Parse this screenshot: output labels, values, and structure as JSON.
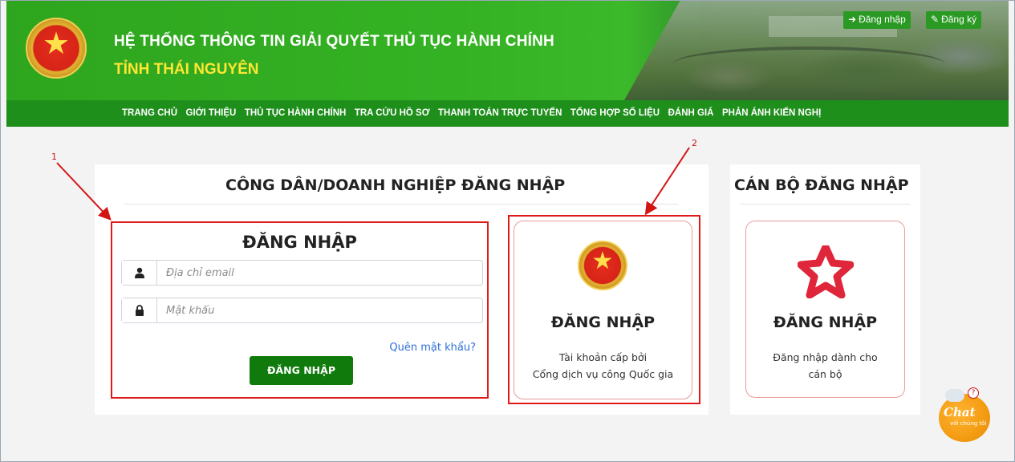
{
  "header": {
    "title_line1": "HỆ THỐNG THÔNG TIN GIẢI QUYẾT THỦ TỤC HÀNH CHÍNH",
    "title_line2": "TỈNH THÁI NGUYÊN",
    "login_label": "Đăng nhập",
    "register_label": "Đăng ký"
  },
  "nav": {
    "items": [
      "TRANG CHỦ",
      "GIỚI THIỆU",
      "THỦ TỤC HÀNH CHÍNH",
      "TRA CỨU HỒ SƠ",
      "THANH TOÁN TRỰC TUYẾN",
      "TỔNG HỢP SỐ LIỆU",
      "ĐÁNH GIÁ",
      "PHẢN ÁNH KIẾN NGHỊ"
    ]
  },
  "citizen": {
    "title": "CÔNG DÂN/DOANH NGHIỆP ĐĂNG NHẬP",
    "form_title": "ĐĂNG NHẬP",
    "email_placeholder": "Địa chỉ email",
    "password_placeholder": "Mật khẩu",
    "forgot_label": "Quên mật khẩu?",
    "submit_label": "ĐĂNG NHẬP",
    "national_card_title": "ĐĂNG NHẬP",
    "national_card_desc1": "Tài khoản cấp bởi",
    "national_card_desc2": "Cổng dịch vụ công Quốc gia"
  },
  "officer": {
    "title": "CÁN BỘ ĐĂNG NHẬP",
    "card_title": "ĐĂNG NHẬP",
    "card_desc1": "Đăng nhập dành cho",
    "card_desc2": "cán bộ"
  },
  "annotations": {
    "label1": "1",
    "label2": "2"
  },
  "chat": {
    "line1": "Chat",
    "line2": "với chúng tôi"
  },
  "colors": {
    "header_green": "#35b224",
    "nav_green": "#1f8f1c",
    "button_green": "#107b0c",
    "highlight_red": "#e01919",
    "link_blue": "#2f6fd6"
  }
}
